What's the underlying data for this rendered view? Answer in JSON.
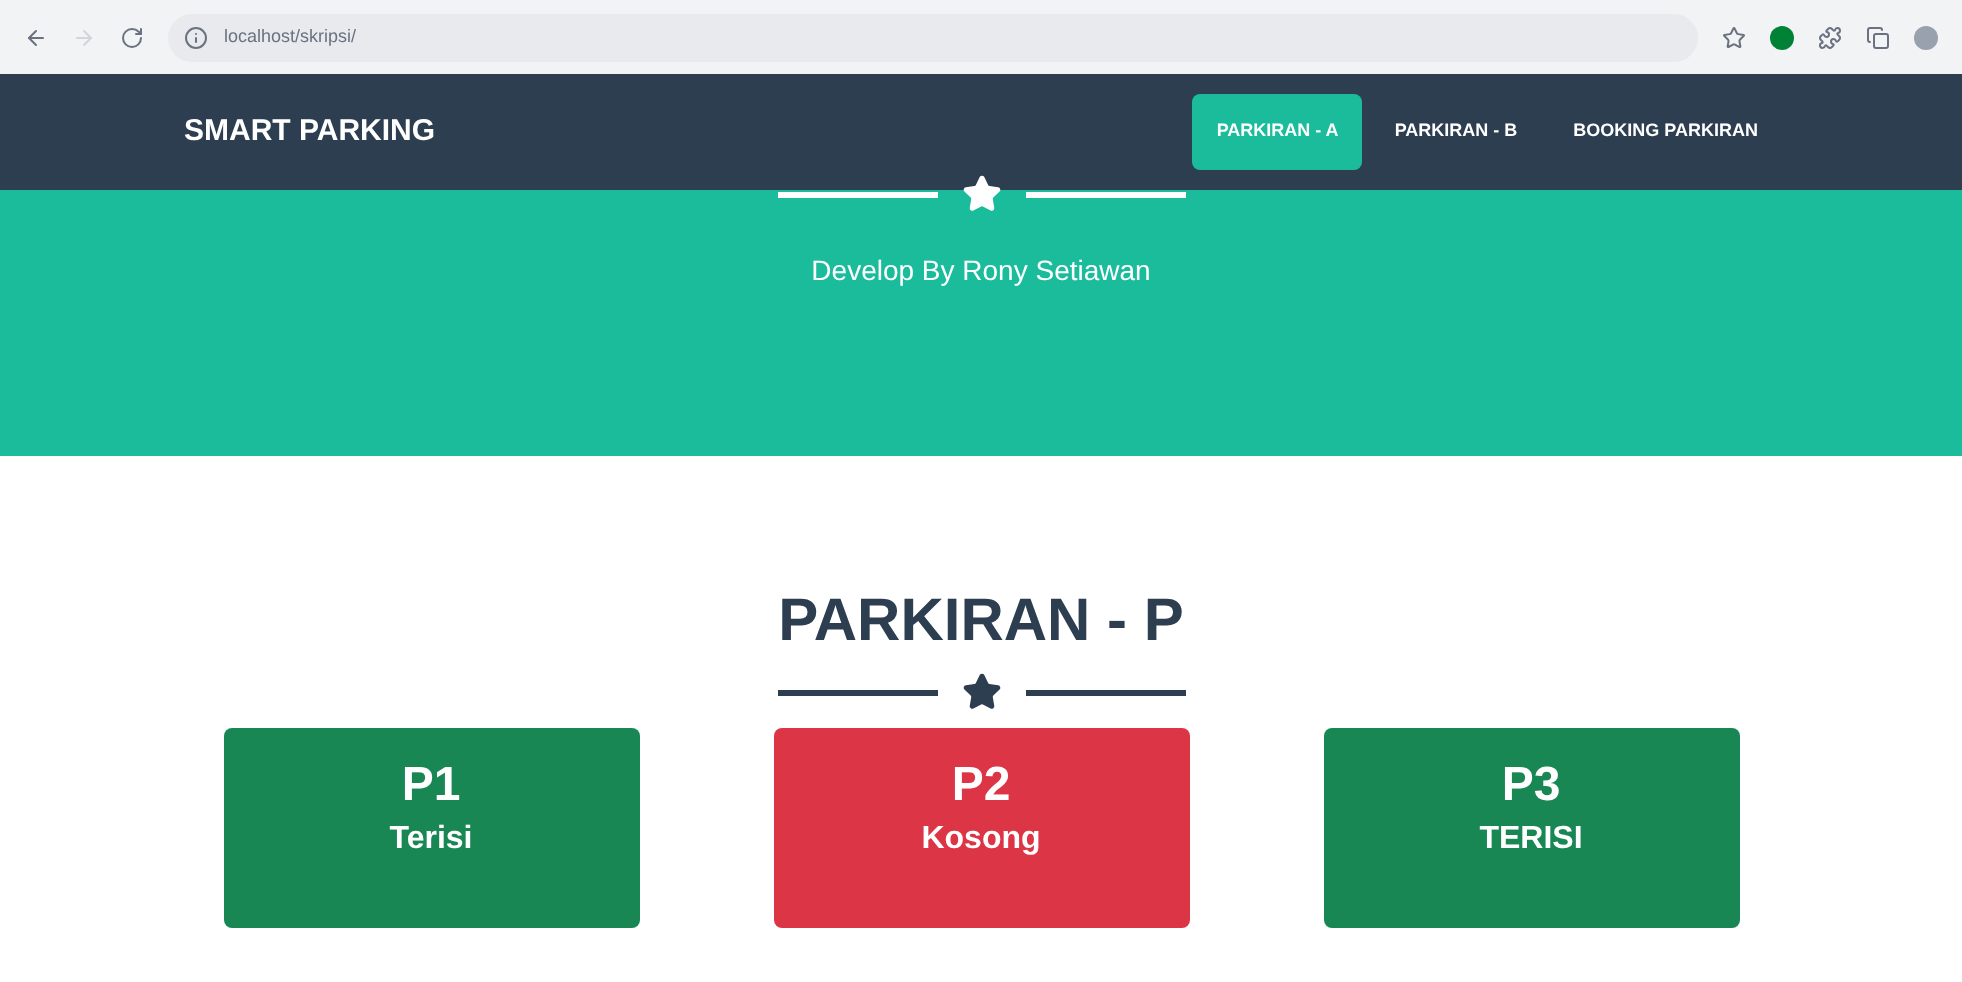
{
  "browser": {
    "url": "localhost/skripsi/"
  },
  "navbar": {
    "brand": "SMART PARKING",
    "links": [
      {
        "label": "PARKIRAN - A",
        "selected": true
      },
      {
        "label": "PARKIRAN - B",
        "selected": false
      },
      {
        "label": "BOOKING PARKIRAN",
        "selected": false
      }
    ]
  },
  "hero": {
    "subtitle": "Develop By Rony Setiawan"
  },
  "section": {
    "title": "PARKIRAN - P",
    "slots": [
      {
        "name": "P1",
        "status": "Terisi",
        "color": "#198754"
      },
      {
        "name": "P2",
        "status": "Kosong",
        "color": "#dc3545"
      },
      {
        "name": "P3",
        "status": "TERISI",
        "color": "#198754"
      }
    ]
  }
}
